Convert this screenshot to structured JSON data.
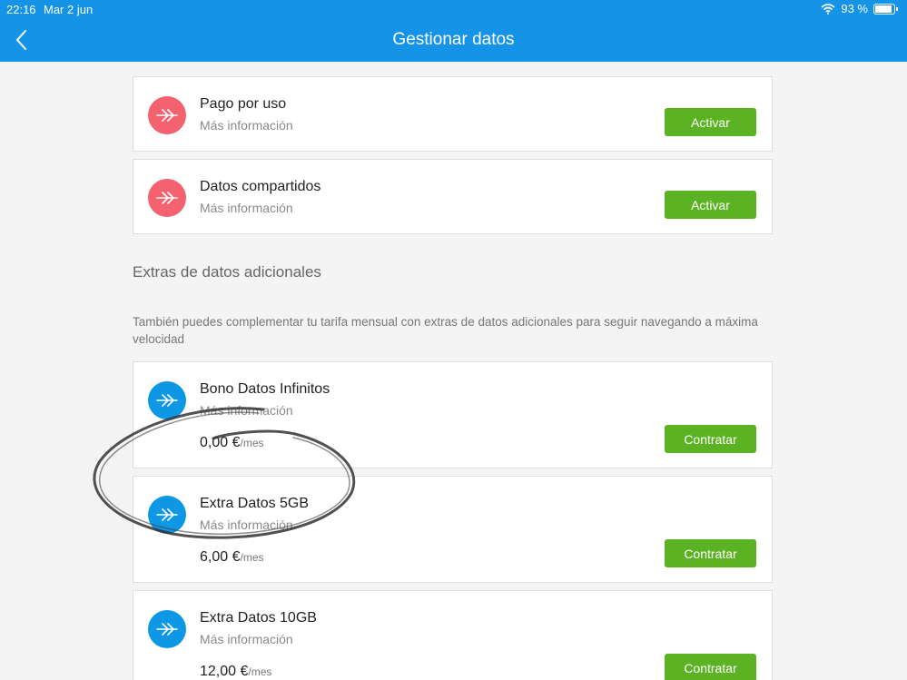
{
  "status_bar": {
    "time": "22:16",
    "date": "Mar 2 jun",
    "battery": "93 %"
  },
  "header": {
    "title": "Gestionar datos",
    "back_icon": "chevron-left-icon",
    "color": "#1593e6"
  },
  "plans": [
    {
      "title": "Pago por uso",
      "link": "Más información",
      "button": "Activar",
      "icon": "data-arrow-icon",
      "icon_color": "#f4616f"
    },
    {
      "title": "Datos compartidos",
      "link": "Más información",
      "button": "Activar",
      "icon": "data-arrow-icon",
      "icon_color": "#f4616f"
    }
  ],
  "extras_section": {
    "heading": "Extras de datos adicionales",
    "description": "También puedes complementar tu tarifa mensual con extras de datos adicionales para seguir navegando a máxima velocidad"
  },
  "extras": [
    {
      "title": "Bono Datos Infinitos",
      "link": "Más información",
      "price": "0,00 €",
      "unit": "/mes",
      "button": "Contratar",
      "icon": "data-arrow-icon",
      "icon_color": "#0d97e5"
    },
    {
      "title": "Extra Datos 5GB",
      "link": "Más información",
      "price": "6,00 €",
      "unit": "/mes",
      "button": "Contratar",
      "icon": "data-arrow-icon",
      "icon_color": "#0d97e5"
    },
    {
      "title": "Extra Datos 10GB",
      "link": "Más información",
      "price": "12,00 €",
      "unit": "/mes",
      "button": "Contratar",
      "icon": "data-arrow-icon",
      "icon_color": "#0d97e5"
    }
  ],
  "button_color": "#5bb324"
}
